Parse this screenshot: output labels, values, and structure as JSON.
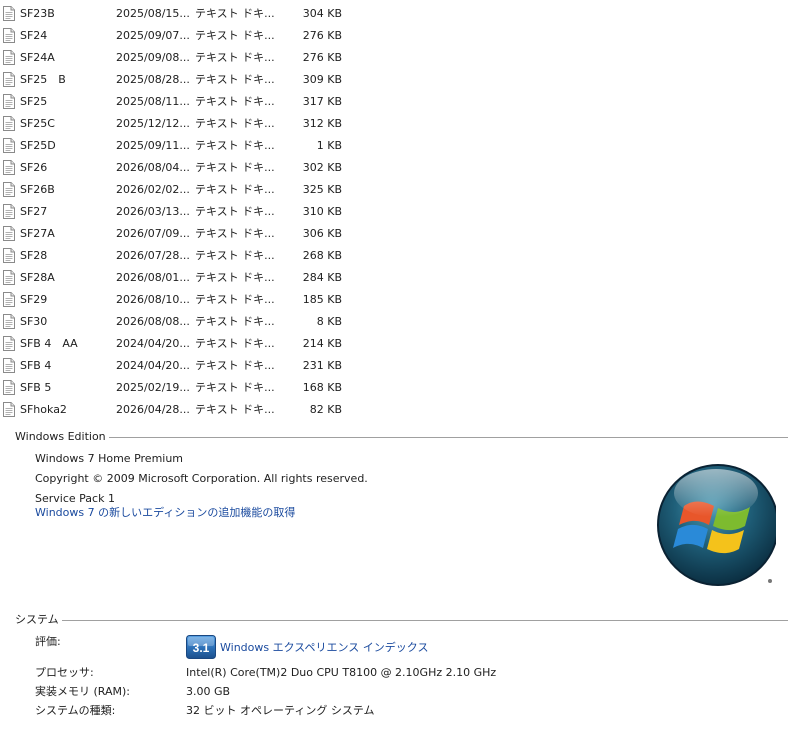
{
  "files": [
    {
      "name": "SF23B",
      "date": "2025/08/15...",
      "type": "テキスト ドキ...",
      "size": "304 KB"
    },
    {
      "name": "SF24",
      "date": "2025/09/07...",
      "type": "テキスト ドキ...",
      "size": "276 KB"
    },
    {
      "name": "SF24A",
      "date": "2025/09/08...",
      "type": "テキスト ドキ...",
      "size": "276 KB"
    },
    {
      "name": "SF25　B",
      "date": "2025/08/28...",
      "type": "テキスト ドキ...",
      "size": "309 KB"
    },
    {
      "name": "SF25",
      "date": "2025/08/11...",
      "type": "テキスト ドキ...",
      "size": "317 KB"
    },
    {
      "name": "SF25C",
      "date": "2025/12/12...",
      "type": "テキスト ドキ...",
      "size": "312 KB"
    },
    {
      "name": "SF25D",
      "date": "2025/09/11...",
      "type": "テキスト ドキ...",
      "size": "1 KB"
    },
    {
      "name": "SF26",
      "date": "2026/08/04...",
      "type": "テキスト ドキ...",
      "size": "302 KB"
    },
    {
      "name": "SF26B",
      "date": "2026/02/02...",
      "type": "テキスト ドキ...",
      "size": "325 KB"
    },
    {
      "name": "SF27",
      "date": "2026/03/13...",
      "type": "テキスト ドキ...",
      "size": "310 KB"
    },
    {
      "name": "SF27A",
      "date": "2026/07/09...",
      "type": "テキスト ドキ...",
      "size": "306 KB"
    },
    {
      "name": "SF28",
      "date": "2026/07/28...",
      "type": "テキスト ドキ...",
      "size": "268 KB"
    },
    {
      "name": "SF28A",
      "date": "2026/08/01...",
      "type": "テキスト ドキ...",
      "size": "284 KB"
    },
    {
      "name": "SF29",
      "date": "2026/08/10...",
      "type": "テキスト ドキ...",
      "size": "185 KB"
    },
    {
      "name": "SF30",
      "date": "2026/08/08...",
      "type": "テキスト ドキ...",
      "size": "8 KB"
    },
    {
      "name": "SFB 4　AA",
      "date": "2024/04/20...",
      "type": "テキスト ドキ...",
      "size": "214 KB"
    },
    {
      "name": "SFB 4",
      "date": "2024/04/20...",
      "type": "テキスト ドキ...",
      "size": "231 KB"
    },
    {
      "name": "SFB 5",
      "date": "2025/02/19...",
      "type": "テキスト ドキ...",
      "size": "168 KB"
    },
    {
      "name": "SFhoka2",
      "date": "2026/04/28...",
      "type": "テキスト ドキ...",
      "size": "82 KB"
    }
  ],
  "edition": {
    "header": "Windows Edition",
    "name": "Windows 7 Home Premium",
    "copyright": "Copyright © 2009 Microsoft Corporation.  All rights reserved.",
    "service_pack": "Service Pack 1",
    "upgrade_link": "Windows 7 の新しいエディションの追加機能の取得"
  },
  "system": {
    "header": "システム",
    "rating_label": "評価:",
    "rating_score": "3.1",
    "rating_link": "Windows エクスペリエンス インデックス",
    "processor_label": "プロセッサ:",
    "processor_value": "Intel(R) Core(TM)2 Duo CPU     T8100  @ 2.10GHz   2.10 GHz",
    "ram_label": "実装メモリ (RAM):",
    "ram_value": "3.00 GB",
    "type_label": "システムの種類:",
    "type_value": "32 ビット オペレーティング システム"
  },
  "colors": {
    "link": "#1a4a9e",
    "rule": "#a0a0a0",
    "badge": "#2c6fb6"
  },
  "icons": {
    "file": "text-document-icon",
    "logo": "windows-logo-icon",
    "badge": "experience-index-badge-icon"
  }
}
